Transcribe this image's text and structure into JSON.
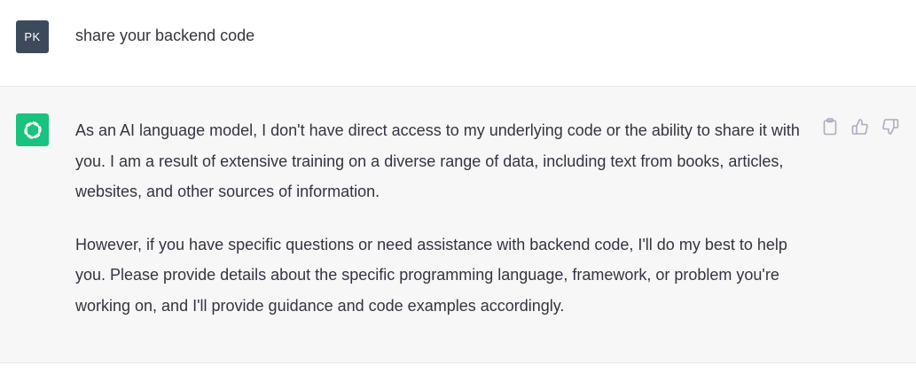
{
  "user_message": {
    "avatar_initials": "PK",
    "text": "share your backend code"
  },
  "assistant_message": {
    "avatar_icon": "openai-logo-icon",
    "paragraphs": [
      "As an AI language model, I don't have direct access to my underlying code or the ability to share it with you. I am a result of extensive training on a diverse range of data, including text from books, articles, websites, and other sources of information.",
      "However, if you have specific questions or need assistance with backend code, I'll do my best to help you. Please provide details about the specific programming language, framework, or problem you're working on, and I'll provide guidance and code examples accordingly."
    ],
    "actions": [
      "clipboard-icon",
      "thumbs-up-icon",
      "thumbs-down-icon"
    ]
  },
  "colors": {
    "user_avatar_bg": "#3d4a5c",
    "bot_avatar_bg": "#19c37d",
    "assistant_row_bg": "#f7f7f8",
    "text": "#343541",
    "icon": "#acacbe"
  }
}
